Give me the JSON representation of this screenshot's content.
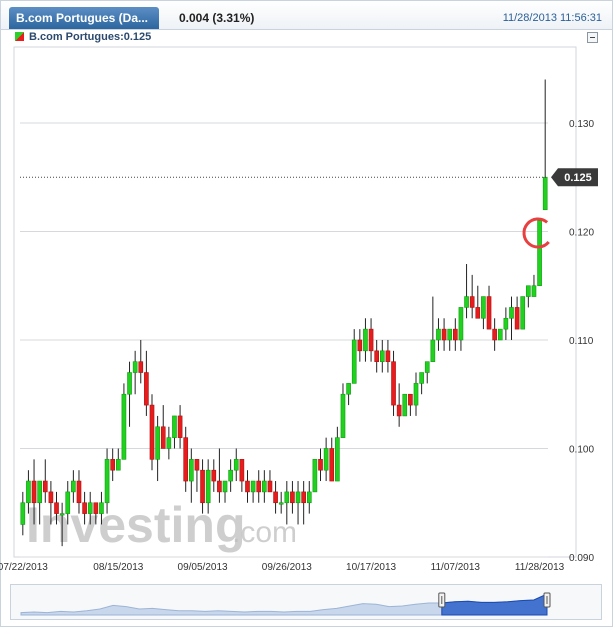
{
  "header": {
    "instrument_tab": "B.com Portugues (Da...",
    "change": "0.004 (3.31%)",
    "datetime": "11/28/2013 11:56:31",
    "legend_label": "B.com Portugues:0.125"
  },
  "watermark": {
    "brand": "Investing",
    "suffix": ".com"
  },
  "colors": {
    "up": "#1ed21e",
    "down": "#e81c1c",
    "grid": "#d5d9dd",
    "price_line": "#444444",
    "navigator": "#2c62c9"
  },
  "chart_data": {
    "type": "candlestick",
    "title": "",
    "xlabel": "",
    "ylabel": "",
    "y_axis_side": "right",
    "ylim": [
      0.09,
      0.137
    ],
    "y_ticks": [
      0.09,
      0.1,
      0.11,
      0.12,
      0.13
    ],
    "y_tick_labels": [
      "0.090",
      "0.100",
      "0.110",
      "0.120",
      "0.130"
    ],
    "last_price": 0.125,
    "last_price_label": "0.125",
    "x_tick_labels": [
      "07/22/2013",
      "08/15/2013",
      "09/05/2013",
      "09/26/2013",
      "10/17/2013",
      "11/07/2013",
      "11/28/2013"
    ],
    "x_tick_index": [
      0,
      17,
      32,
      47,
      62,
      77,
      92
    ],
    "grid": true,
    "legend": "top-left",
    "ohlc": [
      [
        0.093,
        0.096,
        0.092,
        0.095
      ],
      [
        0.095,
        0.098,
        0.094,
        0.097
      ],
      [
        0.097,
        0.099,
        0.093,
        0.095
      ],
      [
        0.095,
        0.097,
        0.093,
        0.097
      ],
      [
        0.097,
        0.099,
        0.095,
        0.096
      ],
      [
        0.096,
        0.097,
        0.093,
        0.095
      ],
      [
        0.095,
        0.096,
        0.093,
        0.094
      ],
      [
        0.094,
        0.095,
        0.091,
        0.094
      ],
      [
        0.094,
        0.097,
        0.093,
        0.096
      ],
      [
        0.096,
        0.098,
        0.095,
        0.097
      ],
      [
        0.097,
        0.098,
        0.094,
        0.095
      ],
      [
        0.095,
        0.096,
        0.093,
        0.094
      ],
      [
        0.094,
        0.096,
        0.093,
        0.095
      ],
      [
        0.095,
        0.095,
        0.093,
        0.094
      ],
      [
        0.094,
        0.096,
        0.093,
        0.095
      ],
      [
        0.095,
        0.1,
        0.094,
        0.099
      ],
      [
        0.099,
        0.1,
        0.097,
        0.098
      ],
      [
        0.098,
        0.1,
        0.098,
        0.099
      ],
      [
        0.099,
        0.106,
        0.099,
        0.105
      ],
      [
        0.105,
        0.108,
        0.102,
        0.107
      ],
      [
        0.107,
        0.109,
        0.105,
        0.108
      ],
      [
        0.108,
        0.11,
        0.106,
        0.107
      ],
      [
        0.107,
        0.109,
        0.103,
        0.104
      ],
      [
        0.104,
        0.105,
        0.098,
        0.099
      ],
      [
        0.099,
        0.103,
        0.097,
        0.102
      ],
      [
        0.102,
        0.104,
        0.1,
        0.1
      ],
      [
        0.1,
        0.102,
        0.099,
        0.101
      ],
      [
        0.101,
        0.103,
        0.1,
        0.103
      ],
      [
        0.103,
        0.104,
        0.1,
        0.101
      ],
      [
        0.101,
        0.102,
        0.096,
        0.097
      ],
      [
        0.097,
        0.1,
        0.095,
        0.099
      ],
      [
        0.099,
        0.099,
        0.096,
        0.098
      ],
      [
        0.098,
        0.099,
        0.094,
        0.095
      ],
      [
        0.095,
        0.099,
        0.094,
        0.098
      ],
      [
        0.098,
        0.099,
        0.096,
        0.097
      ],
      [
        0.097,
        0.1,
        0.095,
        0.096
      ],
      [
        0.096,
        0.097,
        0.095,
        0.097
      ],
      [
        0.097,
        0.099,
        0.096,
        0.098
      ],
      [
        0.098,
        0.1,
        0.097,
        0.099
      ],
      [
        0.099,
        0.099,
        0.096,
        0.097
      ],
      [
        0.097,
        0.098,
        0.095,
        0.096
      ],
      [
        0.096,
        0.097,
        0.095,
        0.097
      ],
      [
        0.097,
        0.098,
        0.095,
        0.096
      ],
      [
        0.096,
        0.098,
        0.095,
        0.097
      ],
      [
        0.097,
        0.098,
        0.096,
        0.096
      ],
      [
        0.096,
        0.097,
        0.094,
        0.095
      ],
      [
        0.095,
        0.096,
        0.094,
        0.095
      ],
      [
        0.095,
        0.097,
        0.093,
        0.096
      ],
      [
        0.096,
        0.097,
        0.094,
        0.095
      ],
      [
        0.095,
        0.097,
        0.093,
        0.096
      ],
      [
        0.096,
        0.097,
        0.093,
        0.095
      ],
      [
        0.095,
        0.097,
        0.094,
        0.096
      ],
      [
        0.096,
        0.099,
        0.096,
        0.099
      ],
      [
        0.099,
        0.1,
        0.097,
        0.098
      ],
      [
        0.098,
        0.101,
        0.097,
        0.1
      ],
      [
        0.1,
        0.101,
        0.097,
        0.097
      ],
      [
        0.097,
        0.102,
        0.097,
        0.101
      ],
      [
        0.101,
        0.106,
        0.101,
        0.105
      ],
      [
        0.105,
        0.106,
        0.104,
        0.106
      ],
      [
        0.106,
        0.111,
        0.106,
        0.11
      ],
      [
        0.11,
        0.111,
        0.108,
        0.109
      ],
      [
        0.109,
        0.112,
        0.108,
        0.111
      ],
      [
        0.111,
        0.112,
        0.108,
        0.109
      ],
      [
        0.109,
        0.11,
        0.107,
        0.108
      ],
      [
        0.108,
        0.11,
        0.107,
        0.109
      ],
      [
        0.109,
        0.11,
        0.107,
        0.108
      ],
      [
        0.108,
        0.109,
        0.103,
        0.104
      ],
      [
        0.104,
        0.106,
        0.102,
        0.103
      ],
      [
        0.103,
        0.105,
        0.103,
        0.105
      ],
      [
        0.105,
        0.105,
        0.103,
        0.104
      ],
      [
        0.104,
        0.107,
        0.103,
        0.106
      ],
      [
        0.106,
        0.107,
        0.105,
        0.107
      ],
      [
        0.107,
        0.108,
        0.106,
        0.108
      ],
      [
        0.108,
        0.114,
        0.108,
        0.11
      ],
      [
        0.11,
        0.112,
        0.109,
        0.111
      ],
      [
        0.111,
        0.112,
        0.109,
        0.11
      ],
      [
        0.11,
        0.111,
        0.109,
        0.111
      ],
      [
        0.111,
        0.112,
        0.109,
        0.11
      ],
      [
        0.11,
        0.113,
        0.109,
        0.113
      ],
      [
        0.113,
        0.117,
        0.112,
        0.114
      ],
      [
        0.114,
        0.116,
        0.112,
        0.113
      ],
      [
        0.113,
        0.115,
        0.112,
        0.112
      ],
      [
        0.112,
        0.114,
        0.111,
        0.114
      ],
      [
        0.114,
        0.115,
        0.111,
        0.111
      ],
      [
        0.111,
        0.112,
        0.109,
        0.11
      ],
      [
        0.11,
        0.111,
        0.11,
        0.111
      ],
      [
        0.111,
        0.113,
        0.11,
        0.112
      ],
      [
        0.112,
        0.114,
        0.11,
        0.113
      ],
      [
        0.113,
        0.114,
        0.112,
        0.111
      ],
      [
        0.111,
        0.114,
        0.111,
        0.114
      ],
      [
        0.114,
        0.115,
        0.113,
        0.115
      ],
      [
        0.114,
        0.116,
        0.114,
        0.115
      ],
      [
        0.115,
        0.121,
        0.115,
        0.121
      ],
      [
        0.122,
        0.134,
        0.122,
        0.125
      ]
    ]
  },
  "navigator": {
    "values": [
      0.094,
      0.095,
      0.094,
      0.096,
      0.095,
      0.097,
      0.1,
      0.106,
      0.104,
      0.1,
      0.101,
      0.099,
      0.097,
      0.097,
      0.096,
      0.097,
      0.096,
      0.095,
      0.096,
      0.096,
      0.095,
      0.096,
      0.096,
      0.099,
      0.101,
      0.105,
      0.109,
      0.108,
      0.104,
      0.105,
      0.108,
      0.11,
      0.11,
      0.112,
      0.113,
      0.111,
      0.111,
      0.112,
      0.114,
      0.115,
      0.125
    ]
  }
}
